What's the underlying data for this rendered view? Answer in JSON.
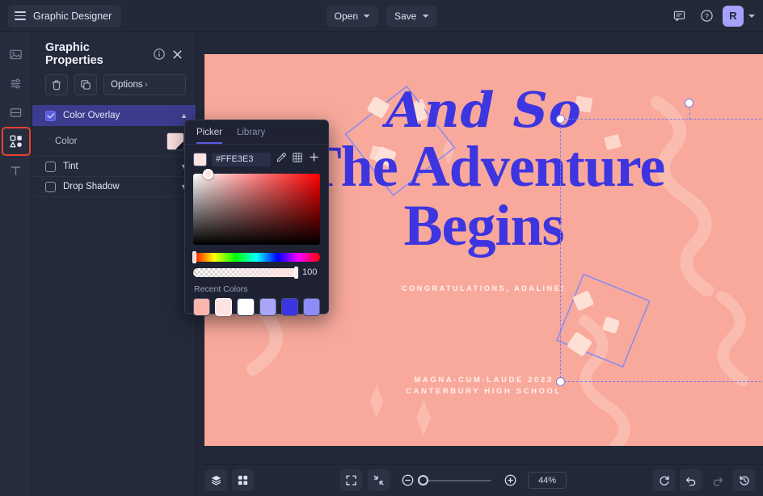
{
  "app": {
    "menu_icon": "hamburger-icon",
    "title": "Graphic Designer",
    "open_label": "Open",
    "save_label": "Save",
    "comment_icon": "comment-icon",
    "help_icon": "help-circle-icon",
    "avatar_initial": "R",
    "avatar_color": "#a5a3fb"
  },
  "rail": {
    "items": [
      {
        "name": "image-tool",
        "icon": "image-icon"
      },
      {
        "name": "adjustments-tool",
        "icon": "sliders-icon"
      },
      {
        "name": "layout-tool",
        "icon": "layout-icon"
      },
      {
        "name": "shapes-tool",
        "icon": "shapes-icon",
        "selected": true
      },
      {
        "name": "text-tool",
        "icon": "text-icon",
        "glyph": "T"
      }
    ],
    "highlight_color": "#e8432b"
  },
  "panel": {
    "title": "Graphic Properties",
    "info_icon": "info-circle-icon",
    "close_icon": "close-icon",
    "delete_icon": "trash-icon",
    "duplicate_icon": "duplicate-icon",
    "options_label": "Options",
    "sections": [
      {
        "label": "Color Overlay",
        "checked": true,
        "expanded": true,
        "highlight": "#3b3c8e"
      },
      {
        "label": "Tint",
        "checked": false,
        "expanded": false
      },
      {
        "label": "Drop Shadow",
        "checked": false,
        "expanded": false
      }
    ],
    "color_row_label": "Color",
    "color_swatch": "#FFE3E3"
  },
  "picker": {
    "tabs": [
      {
        "label": "Picker",
        "active": true
      },
      {
        "label": "Library",
        "active": false
      }
    ],
    "hex_value": "#FFE3E3",
    "swatch": "#FFE3E3",
    "eyedropper_icon": "eyedropper-icon",
    "grid_icon": "grid-icon",
    "add_icon": "plus-icon",
    "opacity_value": "100",
    "recent_label": "Recent Colors",
    "recent_colors": [
      {
        "hex": "#FCB5AA",
        "selected": false
      },
      {
        "hex": "#FFE3E3",
        "selected": true
      },
      {
        "hex": "#FFFFFF",
        "selected": false
      },
      {
        "hex": "#A9A6FA",
        "selected": false
      },
      {
        "hex": "#3B35E2",
        "selected": false
      },
      {
        "hex": "#8E8CF7",
        "selected": false
      }
    ]
  },
  "canvas": {
    "background": "#F9A99C",
    "accent": "#3C35E0",
    "headline_script": "And So",
    "headline_line1": "The Adventure",
    "headline_line2": "Begins",
    "subtitle": "CONGRATULATIONS, ADALINE!",
    "footer_line1": "MAGNA-CUM-LAUDE 2023",
    "footer_line2": "CANTERBURY HIGH SCHOOL"
  },
  "bottombar": {
    "layers_icon": "layers-icon",
    "grid_icon": "grid-view-icon",
    "fit_icon": "fit-screen-icon",
    "collapse_icon": "collapse-icon",
    "zoom_out_icon": "zoom-out-icon",
    "zoom_in_icon": "zoom-in-icon",
    "zoom_value": "44%",
    "refresh_icon": "refresh-icon",
    "undo_icon": "undo-icon",
    "redo_icon": "redo-icon",
    "history_icon": "history-icon"
  }
}
